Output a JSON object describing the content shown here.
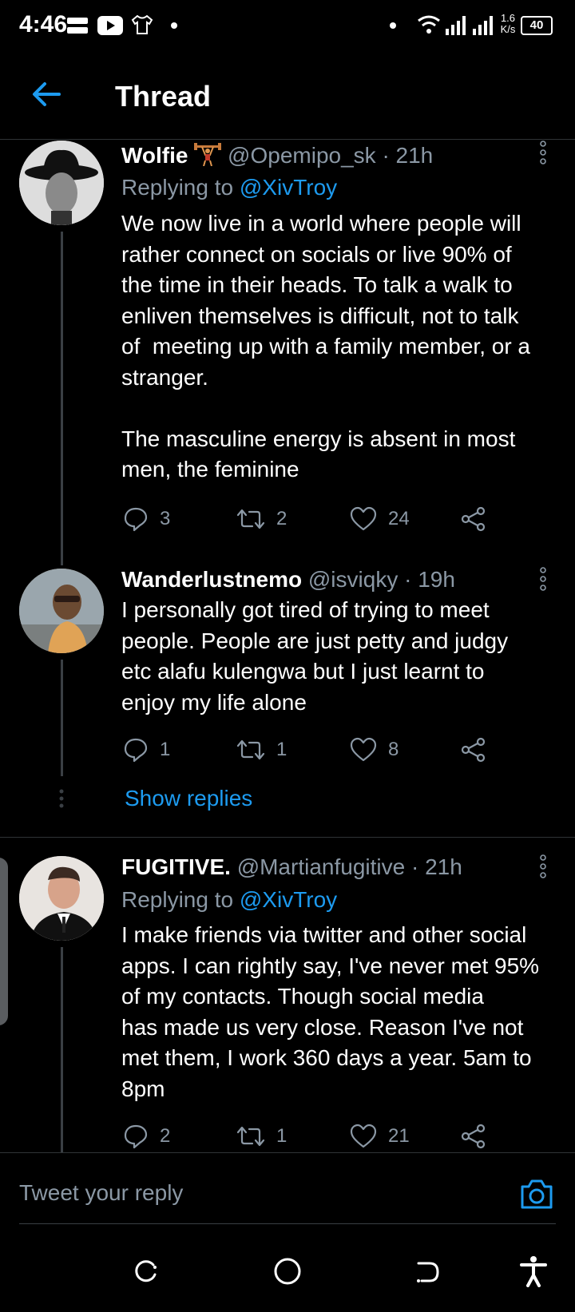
{
  "status": {
    "time": "4:46",
    "speed_top": "1.6",
    "speed_unit": "K/s",
    "battery": "40"
  },
  "header": {
    "title": "Thread"
  },
  "tweets": [
    {
      "name": "Wolfie",
      "handle": "@Opemipo_sk",
      "time": "· 21h",
      "replying_prefix": "Replying to ",
      "replying_to": "@XivTroy",
      "body": "We now live in a world where people will\nrather connect on socials or live 90% of\nthe time in their heads. To talk a walk to\nenliven themselves is difficult, not to talk\nof  meeting up with a family member, or a\nstranger.\n\nThe masculine energy is absent in most\nmen, the feminine",
      "replies": "3",
      "retweets": "2",
      "likes": "24"
    },
    {
      "name": "Wanderlustnemo",
      "handle": "@isviqky",
      "time": "· 19h",
      "body": "I personally got tired of trying to meet\npeople. People are just petty and judgy\netc alafu kulengwa but I just learnt to\nenjoy my life alone",
      "replies": "1",
      "retweets": "1",
      "likes": "8"
    },
    {
      "name": "FUGITIVE.",
      "handle": "@Martianfugitive",
      "time": "· 21h",
      "replying_prefix": "Replying to ",
      "replying_to": "@XivTroy",
      "body": "I make friends via twitter and other social\napps. I can rightly say, I've never met 95%\nof my contacts. Though social media\nhas made us very close. Reason I've not\nmet them, I work 360 days a year. 5am to\n8pm",
      "replies": "2",
      "retweets": "1",
      "likes": "21"
    }
  ],
  "show_replies": "Show replies",
  "composer": {
    "placeholder": "Tweet your reply"
  },
  "colors": {
    "accent": "#1d9bf0",
    "muted": "#8b98a5",
    "background": "#000000"
  },
  "icons": [
    "back-arrow-icon",
    "more-vertical-icon",
    "reply-icon",
    "retweet-icon",
    "like-icon",
    "share-icon",
    "camera-icon",
    "recents-icon",
    "home-icon",
    "back-nav-icon",
    "accessibility-icon"
  ]
}
